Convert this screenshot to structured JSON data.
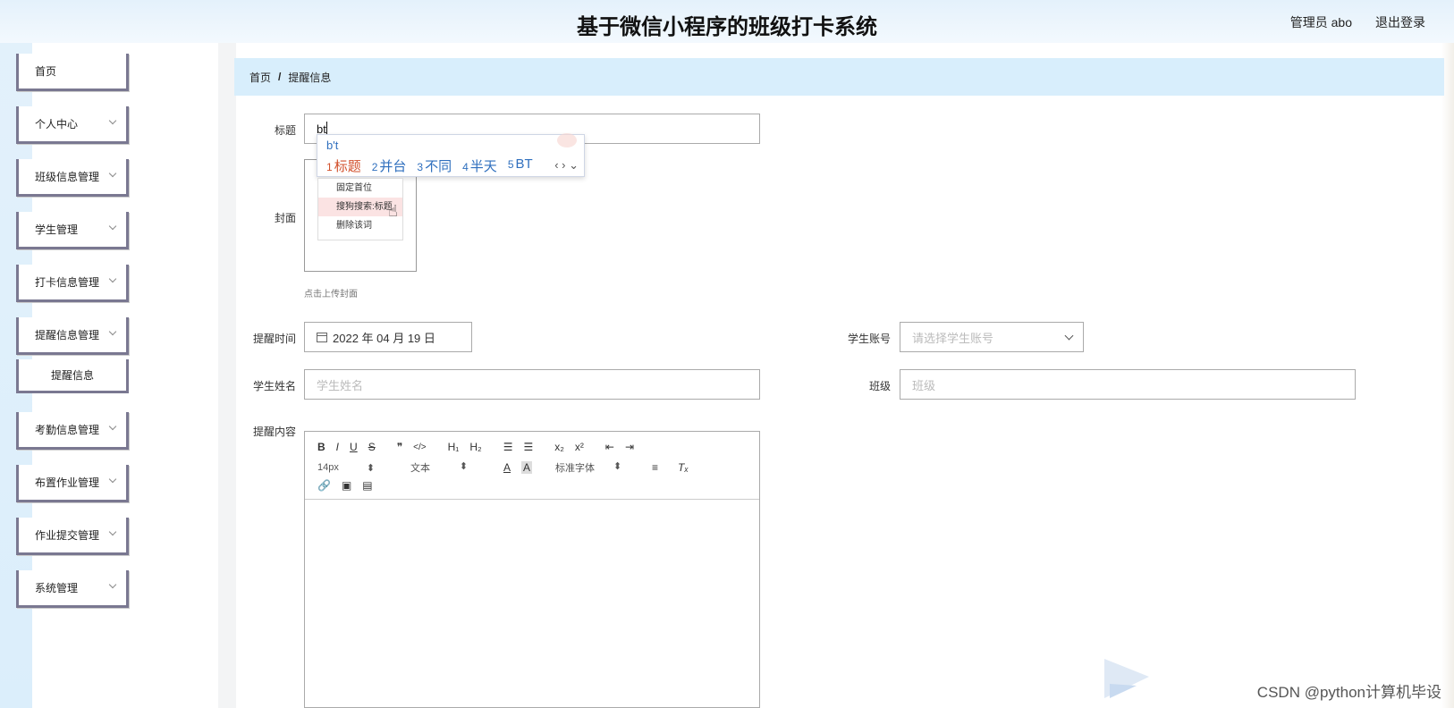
{
  "header": {
    "title": "基于微信小程序的班级打卡系统",
    "user": "管理员 abo",
    "logout": "退出登录"
  },
  "sidebar": {
    "items": [
      {
        "label": "首页",
        "has_chevron": false
      },
      {
        "label": "个人中心",
        "has_chevron": true
      },
      {
        "label": "班级信息管理",
        "has_chevron": true
      },
      {
        "label": "学生管理",
        "has_chevron": true
      },
      {
        "label": "打卡信息管理",
        "has_chevron": true
      },
      {
        "label": "提醒信息管理",
        "has_chevron": true
      },
      {
        "label": "考勤信息管理",
        "has_chevron": true
      },
      {
        "label": "布置作业管理",
        "has_chevron": true
      },
      {
        "label": "作业提交管理",
        "has_chevron": true
      },
      {
        "label": "系统管理",
        "has_chevron": true
      }
    ],
    "subitem": "提醒信息"
  },
  "breadcrumb": {
    "home": "首页",
    "sep": "/",
    "current": "提醒信息"
  },
  "form": {
    "title_label": "标题",
    "title_value": "bt",
    "cover_label": "封面",
    "cover_hint": "点击上传封面",
    "time_label": "提醒时间",
    "time_value": "2022 年 04 月 19 日",
    "account_label": "学生账号",
    "account_placeholder": "请选择学生账号",
    "name_label": "学生姓名",
    "name_placeholder": "学生姓名",
    "class_label": "班级",
    "class_placeholder": "班级",
    "content_label": "提醒内容"
  },
  "ime": {
    "pinyin": "b't",
    "candidates": [
      {
        "idx": "1",
        "text": "标题"
      },
      {
        "idx": "2",
        "text": "并台"
      },
      {
        "idx": "3",
        "text": "不同"
      },
      {
        "idx": "4",
        "text": "半天"
      },
      {
        "idx": "5",
        "text": "BT"
      }
    ],
    "nav": "‹ › ⌄"
  },
  "context_menu": {
    "items": [
      "固定首位",
      "搜狗搜索:标题",
      "删除该词"
    ]
  },
  "editor": {
    "row1": [
      "B",
      "I",
      "U",
      "S",
      "❞",
      "</>",
      "H₁",
      "H₂",
      "☰",
      "☰",
      "x₂",
      "x²",
      "⇤",
      "⇥"
    ],
    "font_size": "14px",
    "text_type": "文本",
    "font_face": "标准字体",
    "row3": [
      "🔗",
      "▣",
      "▤"
    ]
  },
  "watermark": "CSDN @python计算机毕设"
}
